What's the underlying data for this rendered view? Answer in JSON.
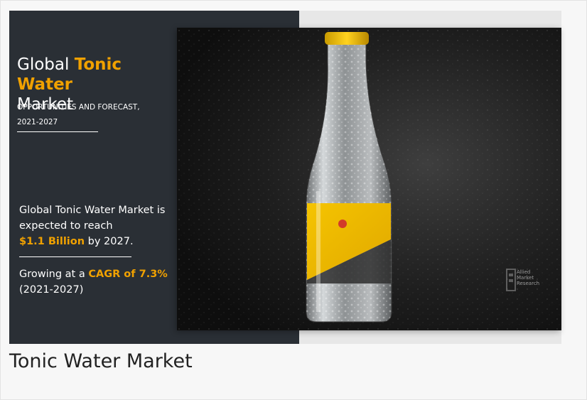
{
  "banner": {
    "title_prefix": "Global ",
    "title_accent": "Tonic Water",
    "title_suffix": "Market",
    "subtitle_line1": "OPPORTUNITIES AND FORECAST,",
    "subtitle_line2": "2021-2027",
    "stat1_text": "Global Tonic Water Market is expected to reach",
    "stat1_value": "$1.1 Billion",
    "stat1_suffix": " by 2027.",
    "stat2_prefix": "Growing at a ",
    "stat2_value": "CAGR of 7.3%",
    "stat2_period": "(2021-2027)",
    "logo_text": "Allied Market Research",
    "colors": {
      "panel": "#2a2f35",
      "accent": "#f0a100",
      "text": "#ffffff"
    }
  },
  "caption": "Tonic Water Market"
}
